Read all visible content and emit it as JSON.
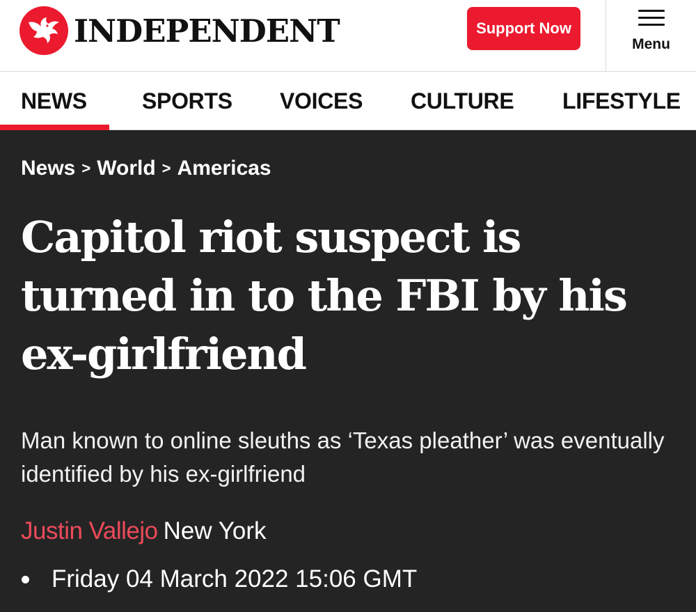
{
  "header": {
    "logo_text": "INDEPENDENT",
    "logo_icon": "eagle-icon",
    "support_label": "Support Now",
    "menu_label": "Menu",
    "menu_icon": "hamburger-icon"
  },
  "nav": {
    "items": [
      {
        "label": "NEWS",
        "active": true
      },
      {
        "label": "SPORTS",
        "active": false
      },
      {
        "label": "VOICES",
        "active": false
      },
      {
        "label": "CULTURE",
        "active": false
      },
      {
        "label": "LIFESTYLE",
        "active": false
      }
    ]
  },
  "breadcrumb": {
    "items": [
      "News",
      "World",
      "Americas"
    ],
    "separator": ">"
  },
  "article": {
    "headline": "Capitol riot suspect is turned in to the FBI by his ex-girlfriend",
    "standfirst": "Man known to online sleuths as ‘Texas pleather’ was eventually identified by his ex-girlfriend",
    "author": "Justin Vallejo",
    "location": "New York",
    "date": "Friday 04 March 2022 15:06 GMT"
  },
  "colors": {
    "brand_red": "#ec1a2e",
    "author_red": "#ec4a5a",
    "article_bg": "#242424",
    "header_bg": "#ffffff"
  }
}
